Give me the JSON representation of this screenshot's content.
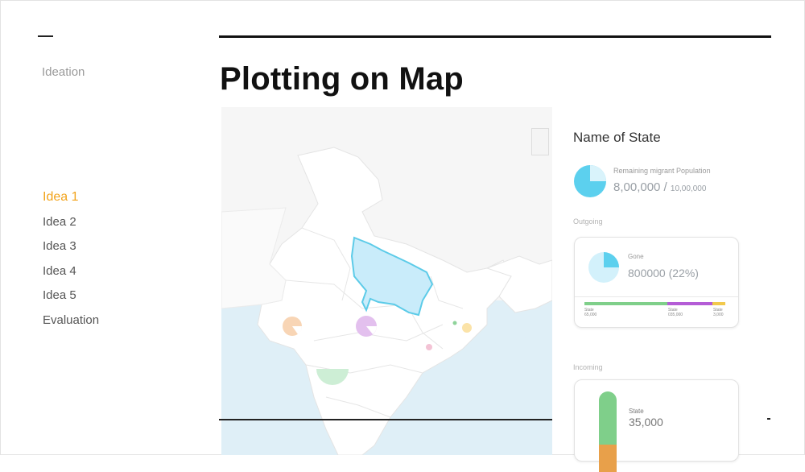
{
  "sidebar": {
    "section_label": "Ideation",
    "items": [
      {
        "label": "Idea 1",
        "active": true
      },
      {
        "label": "Idea 2",
        "active": false
      },
      {
        "label": "Idea 3",
        "active": false
      },
      {
        "label": "Idea 4",
        "active": false
      },
      {
        "label": "Idea 5",
        "active": false
      },
      {
        "label": "Evaluation",
        "active": false
      }
    ]
  },
  "main": {
    "title": "Plotting on Map"
  },
  "info": {
    "state_name": "Name of State",
    "remaining_label": "Remaining migrant Population",
    "remaining_value": "8,00,000",
    "remaining_sep": " / ",
    "remaining_total": "10,00,000",
    "outgoing_label": "Outgoing",
    "gone_label": "Gone",
    "gone_value": "800000",
    "gone_percent": "(22%)",
    "bar_labels": [
      {
        "name": "State",
        "value": "65,000"
      },
      {
        "name": "State",
        "value": "035,000"
      },
      {
        "name": "State",
        "value": "3,000"
      }
    ],
    "incoming_label": "Incoming",
    "incoming_state": "State",
    "incoming_value": "35,000"
  },
  "colors": {
    "accent": "#f2a31b",
    "highlight_state": "#c9ecfa",
    "highlight_stroke": "#5ccbe8",
    "pie_blue": "#5cd0ee",
    "bar_green": "#7fcf8a",
    "bar_purple": "#b45cd6",
    "bar_yellow": "#f2c94c",
    "bar_orange": "#e8a04a"
  }
}
